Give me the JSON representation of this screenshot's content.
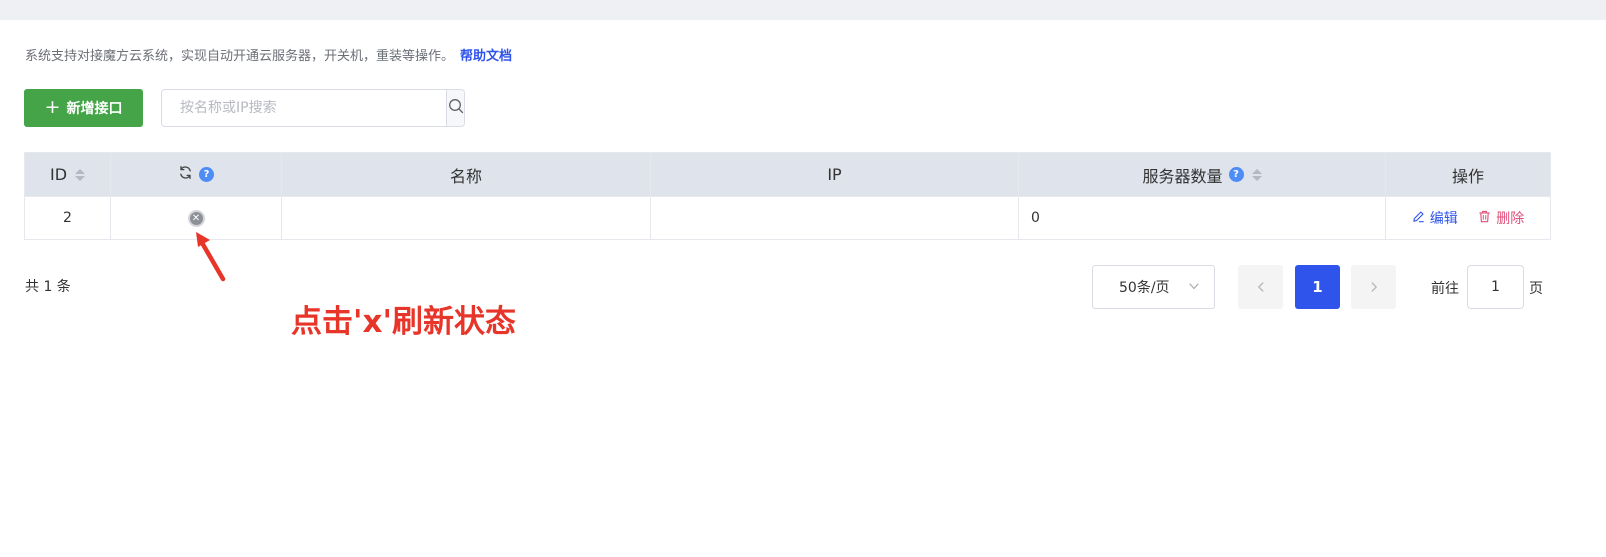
{
  "description": {
    "text": "系统支持对接魔方云系统，实现自动开通云服务器，开关机，重装等操作。",
    "help_link": "帮助文档"
  },
  "toolbar": {
    "add_button_label": "新增接口",
    "search_placeholder": "按名称或IP搜索",
    "search_icon": "search-icon"
  },
  "table": {
    "columns": {
      "id": "ID",
      "status": "",
      "name": "名称",
      "ip": "IP",
      "server_count": "服务器数量",
      "actions": "操作"
    },
    "rows": [
      {
        "id": "2",
        "status_icon": "close-circle-icon",
        "name": "",
        "ip": "",
        "server_count": "0",
        "edit_label": "编辑",
        "delete_label": "删除"
      }
    ]
  },
  "pagination": {
    "total_text": "共 1 条",
    "page_size": "50条/页",
    "current_page": "1",
    "goto_label": "前往",
    "goto_value": "1",
    "goto_suffix": "页"
  },
  "annotation": {
    "text": "点击'x'刷新状态"
  },
  "colors": {
    "primary_blue": "#2f54eb",
    "add_green": "#44a447",
    "header_bg": "#dfe3ec",
    "delete_pink": "#e04f7a",
    "annotation_red": "#e8352a"
  }
}
